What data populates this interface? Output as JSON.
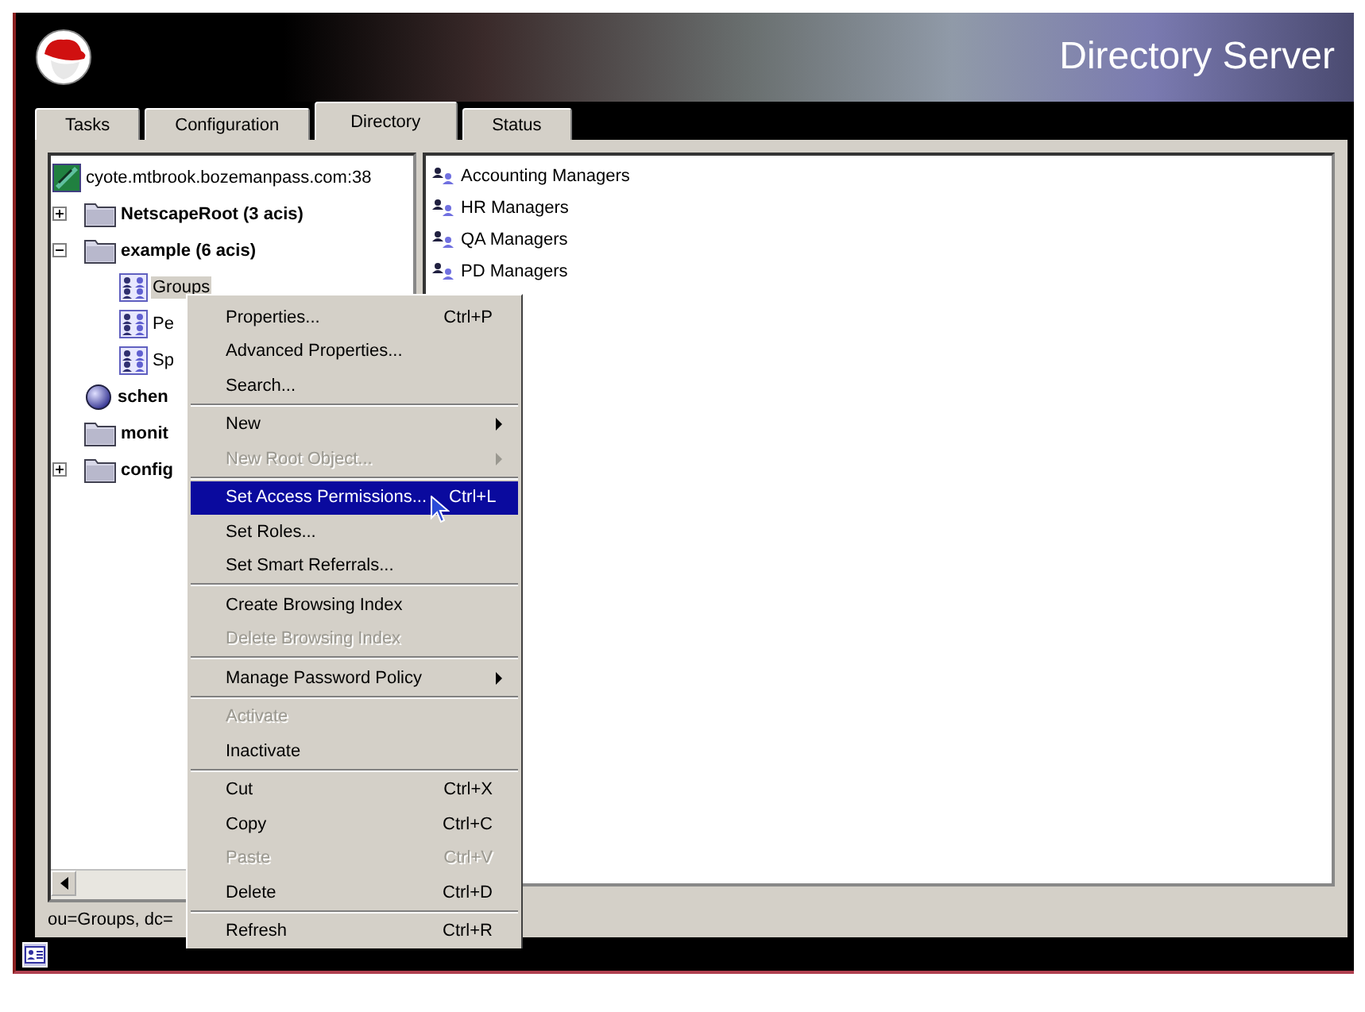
{
  "header": {
    "title": "Directory Server"
  },
  "tabs": [
    {
      "label": "Tasks",
      "selected": false
    },
    {
      "label": "Configuration",
      "selected": false
    },
    {
      "label": "Directory",
      "selected": true
    },
    {
      "label": "Status",
      "selected": false
    }
  ],
  "tree": [
    {
      "label": "cyote.mtbrook.bozemanpass.com:38",
      "kind": "server",
      "bold": false,
      "selected": false,
      "children": [
        {
          "label": "NetscapeRoot  (3 acis)",
          "kind": "folder",
          "bold": true,
          "selected": false,
          "expanded": false
        },
        {
          "label": "example  (6 acis)",
          "kind": "folder",
          "bold": true,
          "selected": false,
          "expanded": true,
          "children": [
            {
              "label": "Groups",
              "kind": "group",
              "bold": false,
              "selected": true
            },
            {
              "label": "Pe",
              "kind": "group",
              "bold": false,
              "selected": false
            },
            {
              "label": "Sp",
              "kind": "group",
              "bold": false,
              "selected": false
            }
          ]
        },
        {
          "label": "schen",
          "kind": "schema",
          "bold": true,
          "selected": false
        },
        {
          "label": "monit",
          "kind": "folder",
          "bold": true,
          "selected": false
        },
        {
          "label": "config",
          "kind": "folder",
          "bold": true,
          "selected": false,
          "expanded": false
        }
      ]
    }
  ],
  "list": [
    {
      "label": "Accounting Managers"
    },
    {
      "label": "HR Managers"
    },
    {
      "label": "QA Managers"
    },
    {
      "label": "PD Managers"
    }
  ],
  "status_bar": {
    "text": "ou=Groups, dc="
  },
  "context_menu": {
    "groups": [
      [
        {
          "label": "Properties...",
          "shortcut": "Ctrl+P",
          "disabled": false,
          "selected": false,
          "submenu": false
        },
        {
          "label": "Advanced Properties...",
          "disabled": false,
          "selected": false,
          "submenu": false
        },
        {
          "label": "Search...",
          "disabled": false,
          "selected": false,
          "submenu": false
        }
      ],
      [
        {
          "label": "New",
          "disabled": false,
          "selected": false,
          "submenu": true
        },
        {
          "label": "New Root Object...",
          "disabled": true,
          "selected": false,
          "submenu": true
        }
      ],
      [
        {
          "label": "Set Access Permissions...",
          "shortcut": "Ctrl+L",
          "disabled": false,
          "selected": true,
          "submenu": false
        },
        {
          "label": "Set Roles...",
          "disabled": false,
          "selected": false,
          "submenu": false
        },
        {
          "label": "Set Smart Referrals...",
          "disabled": false,
          "selected": false,
          "submenu": false
        }
      ],
      [
        {
          "label": "Create Browsing Index",
          "disabled": false,
          "selected": false,
          "submenu": false
        },
        {
          "label": "Delete Browsing Index",
          "disabled": true,
          "selected": false,
          "submenu": false
        }
      ],
      [
        {
          "label": "Manage Password Policy",
          "disabled": false,
          "selected": false,
          "submenu": true
        }
      ],
      [
        {
          "label": "Activate",
          "disabled": true,
          "selected": false,
          "submenu": false
        },
        {
          "label": "Inactivate",
          "disabled": false,
          "selected": false,
          "submenu": false
        }
      ],
      [
        {
          "label": "Cut",
          "shortcut": "Ctrl+X",
          "disabled": false,
          "selected": false,
          "submenu": false
        },
        {
          "label": "Copy",
          "shortcut": "Ctrl+C",
          "disabled": false,
          "selected": false,
          "submenu": false
        },
        {
          "label": "Paste",
          "shortcut": "Ctrl+V",
          "disabled": true,
          "selected": false,
          "submenu": false
        },
        {
          "label": "Delete",
          "shortcut": "Ctrl+D",
          "disabled": false,
          "selected": false,
          "submenu": false
        }
      ],
      [
        {
          "label": "Refresh",
          "shortcut": "Ctrl+R",
          "disabled": false,
          "selected": false,
          "submenu": false
        }
      ]
    ]
  }
}
